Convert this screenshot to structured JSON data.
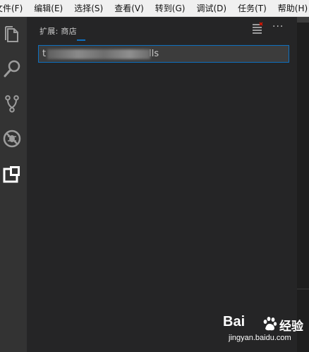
{
  "menubar": {
    "items": [
      "文件(F)",
      "编辑(E)",
      "选择(S)",
      "查看(V)",
      "转到(G)",
      "调试(D)",
      "任务(T)",
      "帮助(H)"
    ]
  },
  "activity_bar": {
    "icons": [
      "explorer-icon",
      "search-icon",
      "source-control-icon",
      "debug-icon",
      "extensions-icon"
    ],
    "active": "extensions-icon"
  },
  "sidebar": {
    "title": "扩展: 商店",
    "actions": [
      "clear-extensions-icon",
      "more-actions-icon"
    ],
    "more_label": "···",
    "search": {
      "value_start": "t",
      "value_end": "lls"
    }
  },
  "watermark": {
    "brand": "Bai",
    "brand_suffix": "经验",
    "url": "jingyan.baidu.com"
  },
  "colors": {
    "activity_bar": "#333333",
    "sidebar": "#252526",
    "editor": "#1e1e1e",
    "accent": "#0e70c0",
    "input_bg": "#3c3c3c"
  }
}
